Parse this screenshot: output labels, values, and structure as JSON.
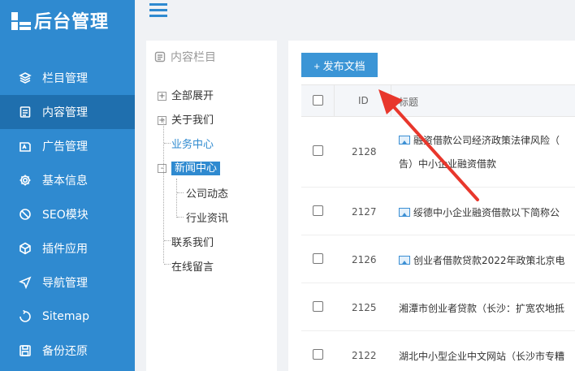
{
  "app": {
    "logo_text": "后台管理"
  },
  "sidebar": {
    "items": [
      {
        "label": "栏目管理",
        "icon": "layers-icon",
        "active": false
      },
      {
        "label": "内容管理",
        "icon": "document-icon",
        "active": true
      },
      {
        "label": "广告管理",
        "icon": "ad-icon",
        "active": false
      },
      {
        "label": "基本信息",
        "icon": "gear-icon",
        "active": false
      },
      {
        "label": "SEO模块",
        "icon": "seo-icon",
        "active": false
      },
      {
        "label": "插件应用",
        "icon": "plugin-icon",
        "active": false
      },
      {
        "label": "导航管理",
        "icon": "navigation-icon",
        "active": false
      },
      {
        "label": "Sitemap",
        "icon": "sitemap-icon",
        "active": false
      },
      {
        "label": "备份还原",
        "icon": "backup-icon",
        "active": false
      }
    ]
  },
  "tree": {
    "title": "内容栏目",
    "nodes": [
      {
        "label": "全部展开",
        "toggle": "+"
      },
      {
        "label": "关于我们",
        "toggle": "+"
      },
      {
        "label": "业务中心"
      },
      {
        "label": "新闻中心",
        "toggle": "-",
        "selected": true
      },
      {
        "label": "公司动态"
      },
      {
        "label": "行业资讯"
      },
      {
        "label": "联系我们"
      },
      {
        "label": "在线留言"
      }
    ]
  },
  "toolbar": {
    "publish_label": "+ 发布文档"
  },
  "table": {
    "headers": {
      "id": "ID",
      "title": "标题"
    },
    "rows": [
      {
        "id": "2128",
        "title": "融资借款公司经济政策法律风险（",
        "title_line2": "告）中小企业融资借款",
        "has_image": true
      },
      {
        "id": "2127",
        "title": "绥德中小企业融资借款以下简称公",
        "has_image": true
      },
      {
        "id": "2126",
        "title": "创业者借款贷款2022年政策北京电",
        "has_image": true
      },
      {
        "id": "2125",
        "title": "湘潭市创业者贷款（长沙：扩宽农地抵",
        "has_image": false
      },
      {
        "id": "2122",
        "title": "湖北中小型企业中文网站（长沙市专糟",
        "has_image": false
      }
    ]
  },
  "colors": {
    "sidebar": "#2f8ad0",
    "sidebar_active": "#1f6fae",
    "accent": "#3b95d6",
    "arrow": "#e8372c"
  }
}
